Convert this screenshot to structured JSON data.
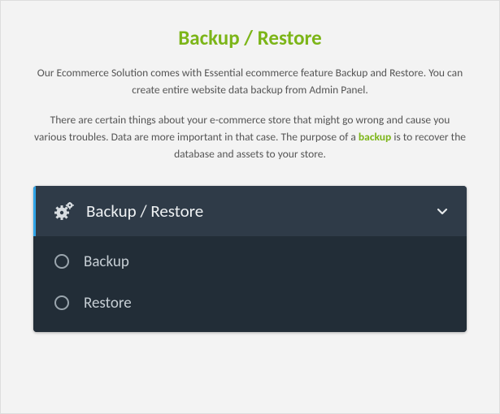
{
  "heading": "Backup / Restore",
  "para1": "Our Ecommerce Solution comes with Essential ecommerce feature Backup and Restore. You can create entire website data backup from Admin Panel.",
  "para2a": "There are certain things about your e-commerce store that might go wrong and cause you various troubles. Data are more important in that case. The purpose of a ",
  "para2_highlight": "backup",
  "para2b": " is to recover the database and assets to your store.",
  "panel": {
    "header": "Backup / Restore",
    "items": [
      "Backup",
      "Restore"
    ]
  }
}
